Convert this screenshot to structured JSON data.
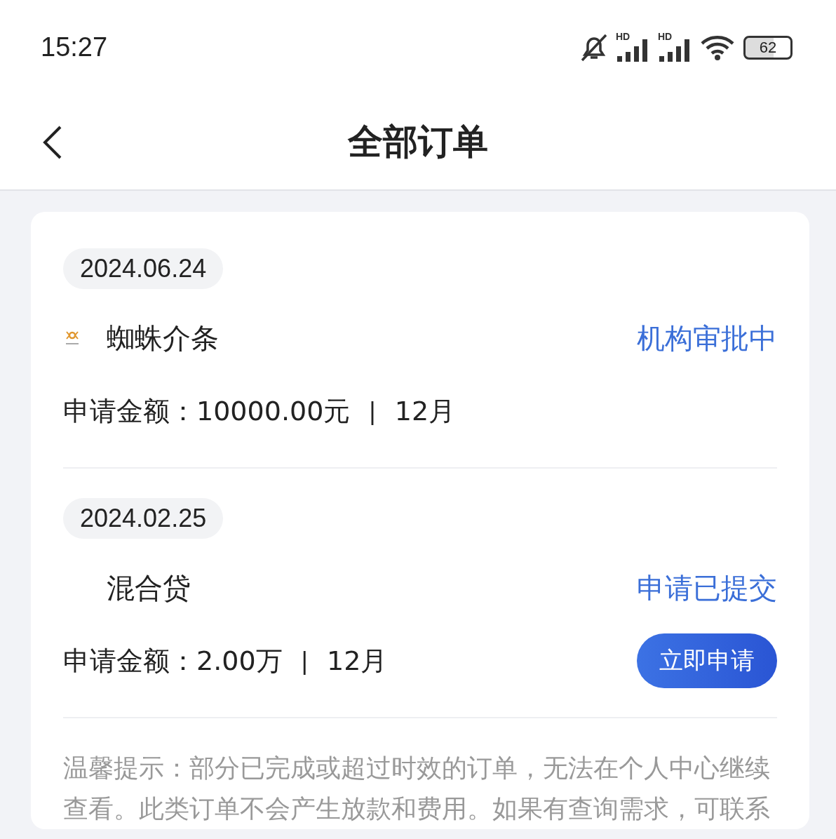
{
  "status_bar": {
    "time": "15:27",
    "signal_labels": [
      "HD",
      "HD"
    ],
    "battery": "62"
  },
  "header": {
    "title": "全部订单"
  },
  "orders": [
    {
      "date": "2024.06.24",
      "has_logo": true,
      "name": "蜘蛛介条",
      "status": "机构审批中",
      "amount": "申请金额：10000.00元",
      "separator": "|",
      "term": "12月"
    },
    {
      "date": "2024.02.25",
      "has_logo": false,
      "name": "混合贷",
      "status": "申请已提交",
      "amount": "申请金额：2.00万",
      "separator": "|",
      "term": "12月",
      "button": "立即申请"
    }
  ],
  "notice": "温馨提示：部分已完成或超过时效的订单，无法在个人中心继续查看。此类订单不会产生放款和费用。如果有查询需求，可联系"
}
